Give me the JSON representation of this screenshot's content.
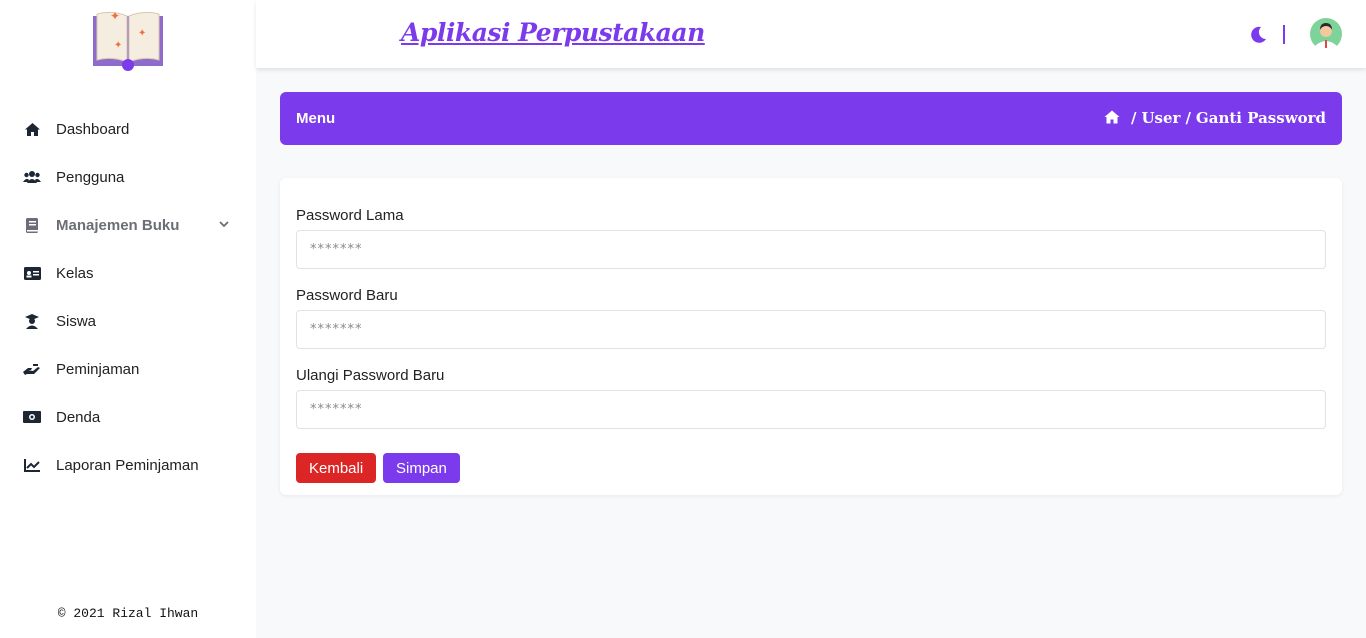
{
  "app": {
    "title": "Aplikasi Perpustakaan"
  },
  "sidebar": {
    "items": [
      {
        "label": "Dashboard",
        "icon": "home-icon"
      },
      {
        "label": "Pengguna",
        "icon": "users-icon"
      },
      {
        "label": "Manajemen Buku",
        "icon": "book-icon",
        "active": true
      },
      {
        "label": "Kelas",
        "icon": "id-card-icon"
      },
      {
        "label": "Siswa",
        "icon": "graduate-icon"
      },
      {
        "label": "Peminjaman",
        "icon": "hand-holding-icon"
      },
      {
        "label": "Denda",
        "icon": "money-icon"
      },
      {
        "label": "Laporan Peminjaman",
        "icon": "chart-line-icon"
      }
    ],
    "footer": "© 2021 Rizal Ihwan"
  },
  "header": {
    "menu_title": "Menu",
    "breadcrumb": [
      "User",
      "Ganti Password"
    ],
    "breadcrumb_separator": "/"
  },
  "form": {
    "old_password": {
      "label": "Password Lama",
      "placeholder": "*******"
    },
    "new_password": {
      "label": "Password Baru",
      "placeholder": "*******"
    },
    "confirm_password": {
      "label": "Ulangi Password Baru",
      "placeholder": "*******"
    },
    "back_label": "Kembali",
    "save_label": "Simpan"
  },
  "colors": {
    "primary": "#7c3aed",
    "danger": "#dc2626",
    "background": "#f8f9fb"
  }
}
